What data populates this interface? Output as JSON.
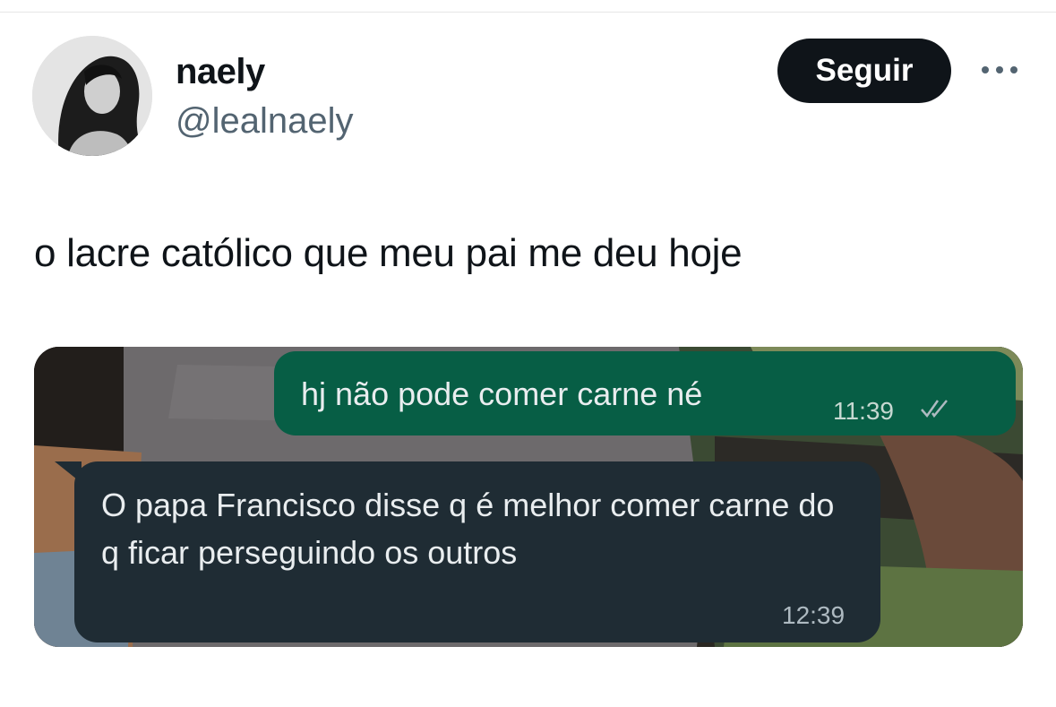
{
  "user": {
    "display_name": "naely",
    "handle": "@lealnaely"
  },
  "actions": {
    "follow_label": "Seguir",
    "more_icon": "more-horizontal-icon"
  },
  "tweet": {
    "text": "o lacre católico que meu pai me deu hoje"
  },
  "chat": {
    "outgoing": {
      "text": "hj não pode comer carne né",
      "time": "11:39",
      "status_icon": "double-check-icon"
    },
    "incoming": {
      "text": "O papa Francisco disse q é melhor comer carne do q ficar perseguindo os outros",
      "time": "12:39"
    }
  },
  "colors": {
    "follow_button_bg": "#0f1419",
    "outgoing_bubble": "#075e45",
    "incoming_bubble": "#1f2c34",
    "handle_text": "#536471"
  }
}
